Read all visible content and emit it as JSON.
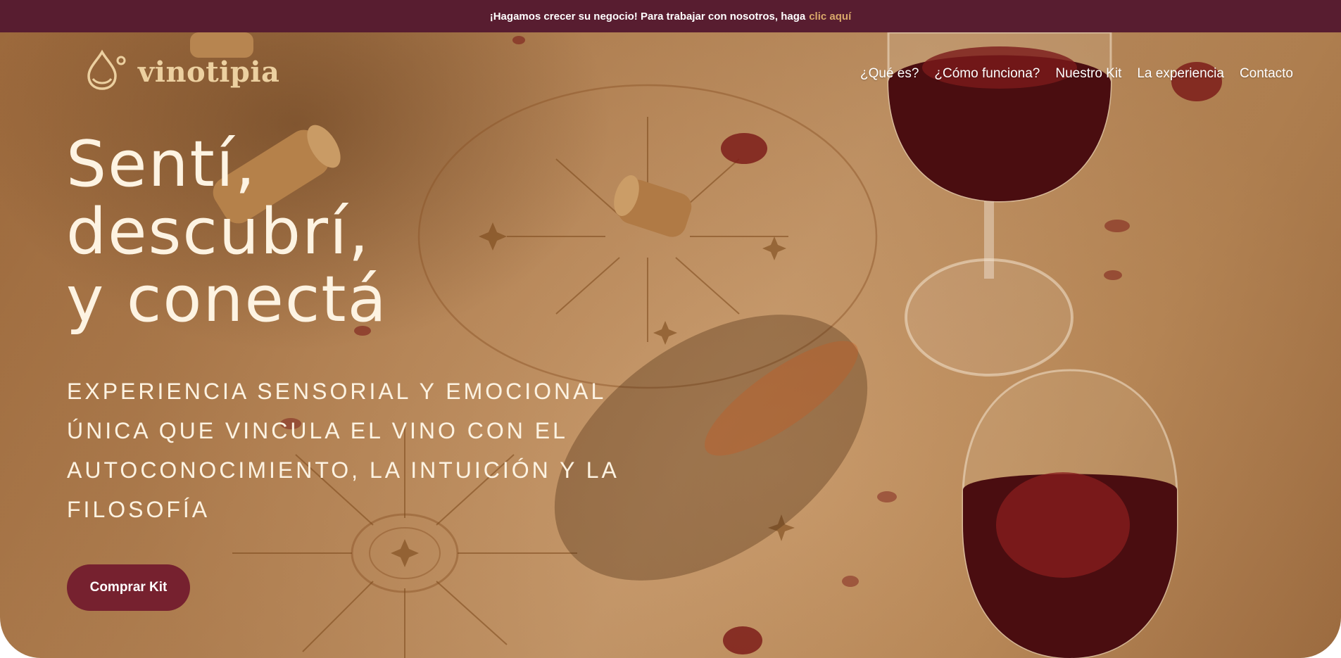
{
  "promo_bar": {
    "message": "¡Hagamos crecer su negocio! Para trabajar con nosotros, haga",
    "link_label": "clic aquí"
  },
  "brand": {
    "name": "vinotipia",
    "logo_icon": "wine-drop-icon"
  },
  "nav": {
    "items": [
      {
        "label": "¿Qué es?"
      },
      {
        "label": "¿Cómo funciona?"
      },
      {
        "label": "Nuestro Kit"
      },
      {
        "label": "La experiencia"
      },
      {
        "label": "Contacto"
      }
    ]
  },
  "hero": {
    "headline": [
      "Sentí,",
      "descubrí,",
      "y conectá"
    ],
    "subtitle": "EXPERIENCIA SENSORIAL Y EMOCIONAL ÚNICA QUE VINCULA EL VINO CON EL AUTOCONOCIMIENTO, LA INTUICIÓN Y LA FILOSOFÍA",
    "cta_label": "Comprar Kit"
  },
  "colors": {
    "promo_bg": "#581d30",
    "promo_link": "#d9a86a",
    "logo": "#ecd0a0",
    "headline": "#fdf3e2",
    "cta_bg": "#76212f"
  }
}
